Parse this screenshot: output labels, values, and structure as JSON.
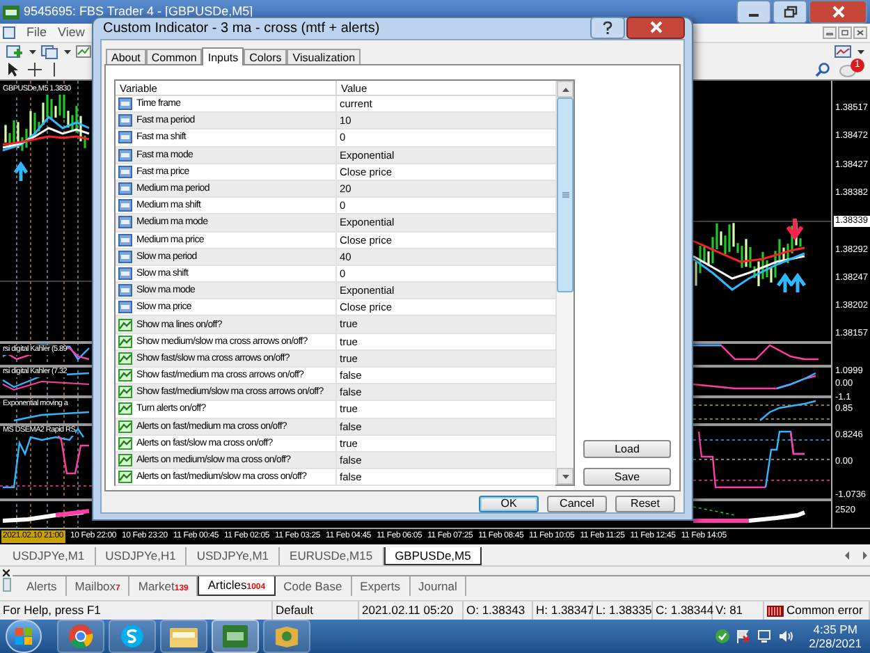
{
  "window": {
    "title": "9545695: FBS Trader 4 - [GBPUSDe,M5]"
  },
  "menu": [
    "File",
    "View"
  ],
  "notification_count": "1",
  "chart": {
    "left_labels": [
      "GBPUSDe,M5 1.3830",
      "rsi digital Kahler (5.89",
      "rsi digital Kahler (7.32",
      "Exponential moving a",
      "MS DSEMA2 Rapid RS"
    ],
    "price_axis": [
      {
        "text": "1.38517",
        "current": false
      },
      {
        "text": "1.38472",
        "current": false
      },
      {
        "text": "1.38427",
        "current": false
      },
      {
        "text": "1.38382",
        "current": false
      },
      {
        "text": "1.38339",
        "current": true
      },
      {
        "text": "1.38292",
        "current": false
      },
      {
        "text": "1.38247",
        "current": false
      },
      {
        "text": "1.38202",
        "current": false
      },
      {
        "text": "1.38157",
        "current": false
      }
    ],
    "sub_axis": [
      "1.0999",
      "0.00",
      "-1.1",
      "0.85",
      "0.8246",
      "0.00",
      "-1.0736",
      "2520"
    ],
    "time_axis": [
      {
        "text": "2021.02.10 21:00",
        "current": true
      },
      {
        "text": "10 Feb 22:00",
        "current": false
      },
      {
        "text": "10 Feb 23:20",
        "current": false
      },
      {
        "text": "11 Feb 00:45",
        "current": false
      },
      {
        "text": "11 Feb 02:05",
        "current": false
      },
      {
        "text": "11 Feb 03:25",
        "current": false
      },
      {
        "text": "11 Feb 04:45",
        "current": false
      },
      {
        "text": "11 Feb 06:05",
        "current": false
      },
      {
        "text": "11 Feb 07:25",
        "current": false
      },
      {
        "text": "11 Feb 08:45",
        "current": false
      },
      {
        "text": "11 Feb 10:05",
        "current": false
      },
      {
        "text": "11 Feb 11:25",
        "current": false
      },
      {
        "text": "11 Feb 12:45",
        "current": false
      },
      {
        "text": "11 Feb 14:05",
        "current": false
      }
    ]
  },
  "dialog": {
    "title": "Custom Indicator - 3 ma - cross  (mtf + alerts)",
    "tabs": [
      {
        "label": "About",
        "selected": false
      },
      {
        "label": "Common",
        "selected": false
      },
      {
        "label": "Inputs",
        "selected": true
      },
      {
        "label": "Colors",
        "selected": false
      },
      {
        "label": "Visualization",
        "selected": false
      }
    ],
    "columns": [
      "Variable",
      "Value"
    ],
    "rows": [
      {
        "variable": "Time frame",
        "value": "current",
        "kind": "number"
      },
      {
        "variable": "Fast ma period",
        "value": "10",
        "kind": "number"
      },
      {
        "variable": "Fast ma shift",
        "value": "0",
        "kind": "number"
      },
      {
        "variable": "Fast ma mode",
        "value": "Exponential",
        "kind": "number"
      },
      {
        "variable": "Fast ma price",
        "value": "Close price",
        "kind": "number"
      },
      {
        "variable": "Medium ma period",
        "value": "20",
        "kind": "number"
      },
      {
        "variable": "Medium ma shift",
        "value": "0",
        "kind": "number"
      },
      {
        "variable": "Medium ma mode",
        "value": "Exponential",
        "kind": "number"
      },
      {
        "variable": "Medium ma price",
        "value": "Close price",
        "kind": "number"
      },
      {
        "variable": "Slow ma period",
        "value": "40",
        "kind": "number"
      },
      {
        "variable": "Slow ma shift",
        "value": "0",
        "kind": "number"
      },
      {
        "variable": "Slow ma mode",
        "value": "Exponential",
        "kind": "number"
      },
      {
        "variable": "Slow ma price",
        "value": "Close price",
        "kind": "number"
      },
      {
        "variable": "Show ma lines on/off?",
        "value": "true",
        "kind": "bool"
      },
      {
        "variable": "Show medium/slow ma cross arrows on/off?",
        "value": "true",
        "kind": "bool"
      },
      {
        "variable": "Show fast/slow ma cross arrows on/off?",
        "value": "true",
        "kind": "bool"
      },
      {
        "variable": "Show fast/medium ma cross arrows on/off?",
        "value": "false",
        "kind": "bool"
      },
      {
        "variable": "Show fast/medium/slow ma cross arrows on/off?",
        "value": "false",
        "kind": "bool"
      },
      {
        "variable": "Turn alerts on/off?",
        "value": "true",
        "kind": "bool"
      },
      {
        "variable": "Alerts on fast/medium ma cross on/off?",
        "value": "false",
        "kind": "bool"
      },
      {
        "variable": "Alerts on fast/slow ma cross on/off?",
        "value": "true",
        "kind": "bool"
      },
      {
        "variable": "Alerts on medium/slow ma cross on/off?",
        "value": "false",
        "kind": "bool"
      },
      {
        "variable": "Alerts on fast/medium/slow ma cross on/off?",
        "value": "false",
        "kind": "bool"
      }
    ],
    "side_buttons": [
      "Load",
      "Save"
    ],
    "buttons": [
      {
        "label": "OK",
        "default": true
      },
      {
        "label": "Cancel",
        "default": false
      },
      {
        "label": "Reset",
        "default": false
      }
    ]
  },
  "chart_tabs": [
    {
      "label": "USDJPYe,M1",
      "selected": false
    },
    {
      "label": "USDJPYe,H1",
      "selected": false
    },
    {
      "label": "USDJPYe,M1",
      "selected": false
    },
    {
      "label": "EURUSDe,M15",
      "selected": false
    },
    {
      "label": "GBPUSDe,M5",
      "selected": true
    }
  ],
  "terminal_tabs": [
    {
      "label": "Alerts",
      "selected": false
    },
    {
      "label": "Mailbox",
      "count": "7",
      "selected": false
    },
    {
      "label": "Market",
      "count": "139",
      "selected": false
    },
    {
      "label": "Articles",
      "count": "1004",
      "selected": true
    },
    {
      "label": "Code Base",
      "selected": false
    },
    {
      "label": "Experts",
      "selected": false
    },
    {
      "label": "Journal",
      "selected": false
    }
  ],
  "status_bar": [
    {
      "text": "For Help, press F1",
      "kind": "text"
    },
    {
      "text": "Default",
      "kind": "text"
    },
    {
      "text": "2021.02.11 05:20",
      "kind": "text"
    },
    {
      "text": "O: 1.38343",
      "kind": "text"
    },
    {
      "text": "H: 1.38347",
      "kind": "text"
    },
    {
      "text": "L: 1.38335",
      "kind": "text"
    },
    {
      "text": "C: 1.38344",
      "kind": "text"
    },
    {
      "text": "V: 81",
      "kind": "text"
    },
    {
      "text": "Common error",
      "kind": "error"
    }
  ],
  "taskbar": {
    "time": "4:35 PM",
    "date": "2/28/2021"
  }
}
